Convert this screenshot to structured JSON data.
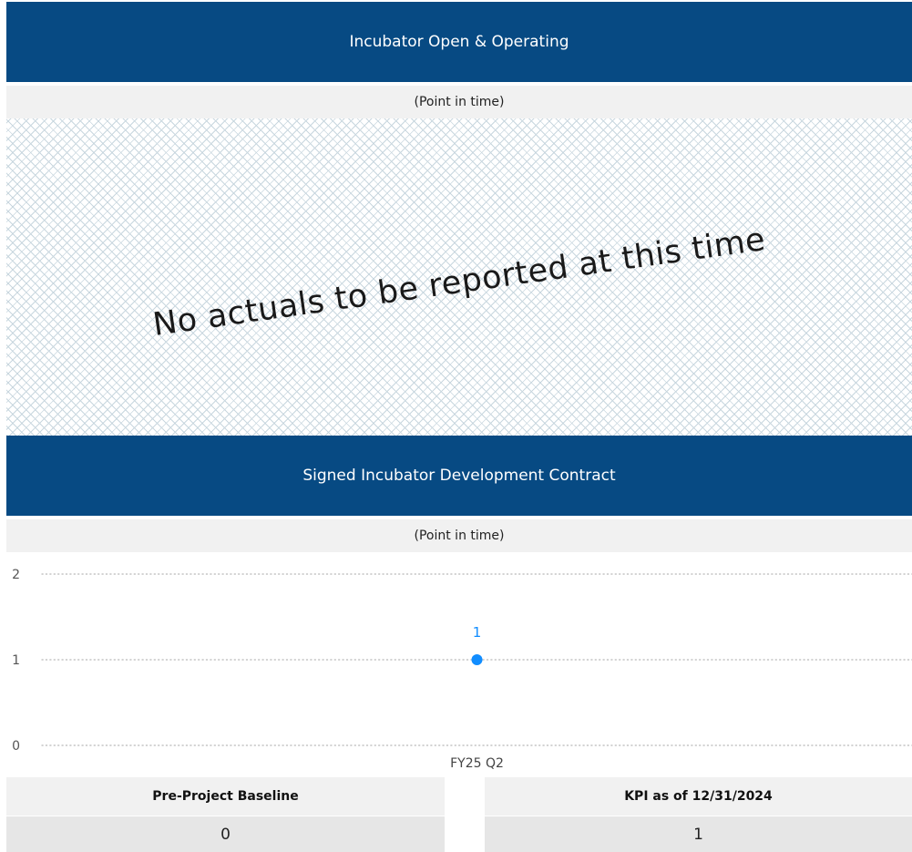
{
  "panel1": {
    "title": "Incubator Open & Operating",
    "subtitle": "(Point in time)",
    "empty_message": "No actuals to be reported at this time"
  },
  "panel2": {
    "title": "Signed Incubator Development Contract",
    "subtitle": "(Point in time)"
  },
  "chart_data": {
    "type": "scatter",
    "categories": [
      "FY25 Q2"
    ],
    "values": [
      1
    ],
    "data_labels": [
      "1"
    ],
    "y_ticks": [
      "0",
      "1",
      "2"
    ],
    "ylim": [
      0,
      2
    ],
    "grid": "dotted horizontal",
    "point_color": "#118dff",
    "label_color": "#118dff"
  },
  "kpi": {
    "baseline_label": "Pre-Project Baseline",
    "baseline_value": "0",
    "current_label": "KPI as of 12/31/2024",
    "current_value": "1"
  },
  "colors": {
    "header_bg": "#074a83",
    "subheader_bg": "#f1f1f1",
    "value_bg": "#e6e6e6"
  }
}
